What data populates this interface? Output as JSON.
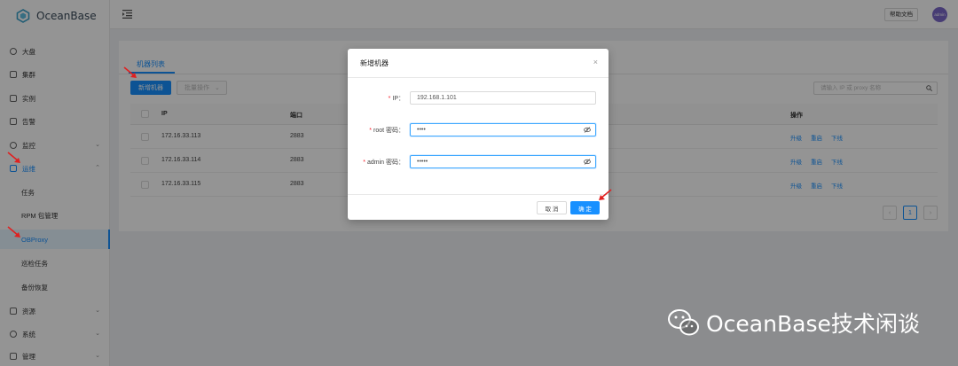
{
  "app": {
    "name": "OceanBase",
    "brand_color": "#1890ff"
  },
  "header": {
    "help_label": "帮助文档",
    "avatar_text": "admin"
  },
  "sidebar": {
    "items": [
      {
        "label": "大盘",
        "icon": "dashboard-icon"
      },
      {
        "label": "集群",
        "icon": "cluster-icon"
      },
      {
        "label": "实例",
        "icon": "instance-icon"
      },
      {
        "label": "告警",
        "icon": "alarm-icon"
      },
      {
        "label": "监控",
        "icon": "monitor-icon",
        "chevron": "⌄"
      },
      {
        "label": "运维",
        "icon": "wrench-icon",
        "chevron": "⌃"
      },
      {
        "label": "任务"
      },
      {
        "label": "RPM 包管理"
      },
      {
        "label": "OBProxy"
      },
      {
        "label": "巡检任务"
      },
      {
        "label": "备份恢复"
      },
      {
        "label": "资源",
        "icon": "resource-icon",
        "chevron": "⌄"
      },
      {
        "label": "系统",
        "icon": "system-icon",
        "chevron": "⌄"
      },
      {
        "label": "管理",
        "icon": "manage-icon",
        "chevron": "⌄"
      }
    ]
  },
  "main": {
    "tab": "机器列表",
    "new_button": "新增机器",
    "batch_button": "批量操作",
    "batch_chevron": "⌄",
    "search_placeholder": "请输入 IP 或 proxy 名称",
    "table": {
      "headers": [
        "IP",
        "端口",
        "操作"
      ],
      "rows": [
        {
          "ip": "172.16.33.113",
          "port": "2883"
        },
        {
          "ip": "172.16.33.114",
          "port": "2883"
        },
        {
          "ip": "172.16.33.115",
          "port": "2883"
        }
      ],
      "actions": [
        "升级",
        "重启",
        "下线"
      ]
    },
    "pager": {
      "prev": "‹",
      "current": "1",
      "next": "›"
    }
  },
  "modal": {
    "title": "新增机器",
    "close": "×",
    "fields": [
      {
        "label": "IP：",
        "value": "192.168.1.101"
      },
      {
        "label": "root 密码：",
        "value": "••••"
      },
      {
        "label": "admin 密码：",
        "value": "•••••"
      }
    ],
    "cancel_label": "取 消",
    "ok_label": "确 定"
  },
  "watermark": {
    "text": "OceanBase技术闲谈"
  }
}
